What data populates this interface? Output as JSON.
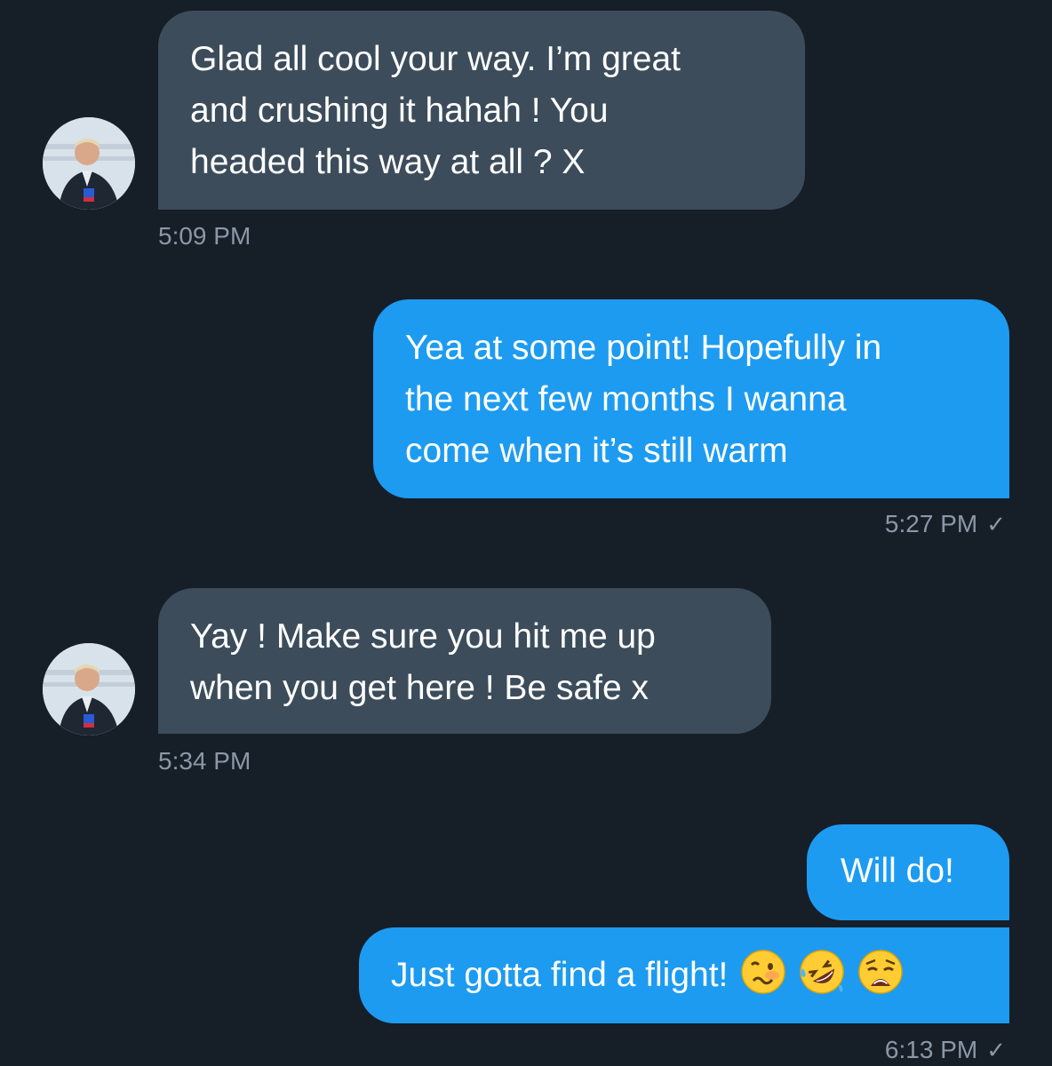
{
  "messages": [
    {
      "direction": "incoming",
      "lines": [
        "Glad all cool your way. I’m great",
        "and crushing it hahah ! You",
        "headed this way at all ? X"
      ],
      "time": "5:09 PM",
      "avatar_icon": "user-avatar-icon"
    },
    {
      "direction": "outgoing",
      "lines": [
        "Yea at some point! Hopefully in",
        "the next few months I wanna",
        "come when it’s still warm"
      ],
      "time": "5:27 PM",
      "status_icon": "check-icon",
      "status_glyph": "✓"
    },
    {
      "direction": "incoming",
      "lines": [
        "Yay ! Make sure you hit me up",
        "when you get here ! Be safe x"
      ],
      "time": "5:34 PM",
      "avatar_icon": "user-avatar-icon"
    },
    {
      "direction": "outgoing",
      "lines": [
        "Will do!"
      ]
    },
    {
      "direction": "outgoing",
      "lines": [
        "Just gotta find a flight!"
      ],
      "emojis": [
        "woozy-face-icon",
        "rolling-on-floor-laughing-icon",
        "weary-face-icon"
      ],
      "time": "6:13 PM",
      "status_icon": "check-icon",
      "status_glyph": "✓"
    }
  ],
  "colors": {
    "background": "#161e28",
    "incoming_bubble": "#3c4c5b",
    "outgoing_bubble": "#1d9bf0",
    "timestamp": "#8b98a5"
  }
}
